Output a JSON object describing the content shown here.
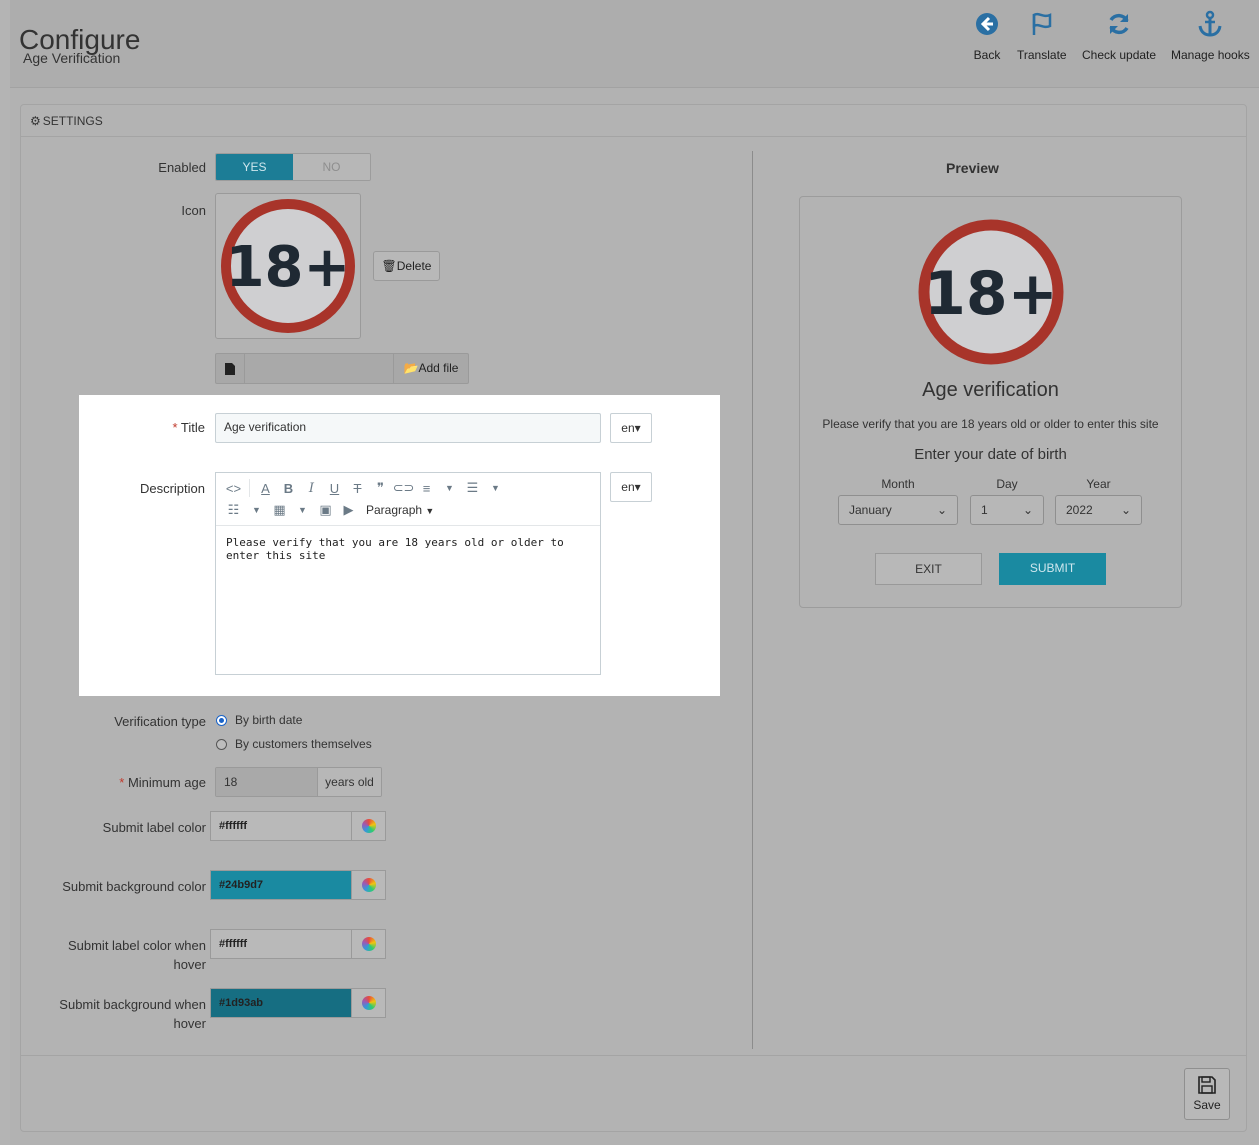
{
  "header": {
    "title": "Configure",
    "subtitle": "Age Verification",
    "toolbar": [
      {
        "label": "Back",
        "icon": "back-icon"
      },
      {
        "label": "Translate",
        "icon": "flag-icon"
      },
      {
        "label": "Check update",
        "icon": "refresh-icon"
      },
      {
        "label": "Manage hooks",
        "icon": "anchor-icon"
      }
    ]
  },
  "panel": {
    "heading": "SETTINGS",
    "save_label": "Save"
  },
  "form": {
    "enabled": {
      "label": "Enabled",
      "yes": "YES",
      "no": "NO",
      "value": "YES"
    },
    "icon": {
      "label": "Icon",
      "badge_text": "18+",
      "delete_label": "Delete",
      "add_file_label": "Add file"
    },
    "title": {
      "label": "Title",
      "value": "Age verification",
      "lang": "en"
    },
    "description": {
      "label": "Description",
      "lang": "en",
      "format": "Paragraph",
      "content": "Please verify that you are 18 years old or older to enter this site"
    },
    "verification_type": {
      "label": "Verification type",
      "options": [
        "By birth date",
        "By customers themselves"
      ],
      "selected": "By birth date"
    },
    "minimum_age": {
      "label": "Minimum age",
      "value": "18",
      "addon": "years old"
    },
    "submit_label_color": {
      "label": "Submit label color",
      "value": "#ffffff"
    },
    "submit_bg_color": {
      "label": "Submit background color",
      "value": "#24b9d7"
    },
    "submit_label_hover": {
      "label_line1": "Submit label color when",
      "label_line2": "hover",
      "value": "#ffffff"
    },
    "submit_bg_hover": {
      "label_line1": "Submit background when",
      "label_line2": "hover",
      "value": "#1d93ab"
    }
  },
  "preview": {
    "title": "Preview",
    "badge_text": "18+",
    "heading": "Age verification",
    "description": "Please verify that you are 18 years old or older to enter this site",
    "subheading": "Enter your date of birth",
    "month_label": "Month",
    "day_label": "Day",
    "year_label": "Year",
    "month_value": "January",
    "day_value": "1",
    "year_value": "2022",
    "exit_label": "EXIT",
    "submit_label": "SUBMIT"
  },
  "colors": {
    "toggle_on": "#1c7d96",
    "submit_bg_display": "#1a8aa1",
    "submit_bg_hover_display": "#166e82",
    "badge_ring": "#c0392b"
  }
}
